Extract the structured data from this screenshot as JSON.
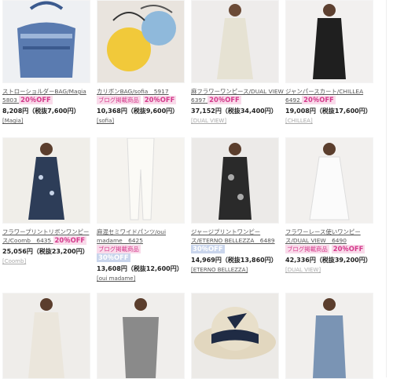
{
  "products": [
    {
      "name": "ストローショルダーBAG/Magia 5803",
      "blog": "",
      "off": "20％OFF",
      "off_style": "pink",
      "price": "8,208円（税抜7,600円）",
      "brand": "[Magia]",
      "brand_grey": false
    },
    {
      "name": "カリボンBAG/sofia　5917",
      "blog": "ブログ掲載商品",
      "off": "20％OFF",
      "off_style": "pink",
      "price": "10,368円（税抜9,600円）",
      "brand": "[sofia]",
      "brand_grey": false
    },
    {
      "name": "麻フラワーワンピース/DUAL VIEW　6397",
      "blog": "",
      "off": "20％OFF",
      "off_style": "pink",
      "price": "37,152円（税抜34,400円）",
      "brand": "[DUAL VIEW]",
      "brand_grey": true
    },
    {
      "name": "ジャンパースカート/CHILLEA 6492",
      "blog": "",
      "off": "20％OFF",
      "off_style": "pink",
      "price": "19,008円（税抜17,600円）",
      "brand": "[CHILLEA]",
      "brand_grey": true
    },
    {
      "name": "フラワープリントリボンワンピース/Coomb　6435",
      "blog": "",
      "off": "20％OFF",
      "off_style": "pink",
      "price": "25,056円（税抜23,200円）",
      "brand": "[Coomb]",
      "brand_grey": true
    },
    {
      "name": "麻混セミワイドパンツ/oui madame　6425",
      "blog": "ブログ掲載商品",
      "off": "30％OFF",
      "off_style": "blue",
      "price": "13,608円（税抜12,600円）",
      "brand": "[oui madame]",
      "brand_grey": false
    },
    {
      "name": "ジャージプリントワンピース/ETERNO BELLEZZA　6489",
      "blog": "",
      "off": "30％OFF",
      "off_style": "blue",
      "price": "14,969円（税抜13,860円）",
      "brand": "[ETERNO BELLEZZA]",
      "brand_grey": false
    },
    {
      "name": "フラワーレース使いワンピース/DUAL VIEW　6490",
      "blog": "ブログ掲載商品",
      "off": "20％OFF",
      "off_style": "pink",
      "price": "42,336円（税抜39,200円）",
      "brand": "[DUAL VIEW]",
      "brand_grey": true
    }
  ],
  "colors": {
    "accent_pink": "#d43a8c",
    "pink_bg": "#f9dbea",
    "blue_bg": "#c9d5ec"
  },
  "icons": [
    "product-photo"
  ]
}
